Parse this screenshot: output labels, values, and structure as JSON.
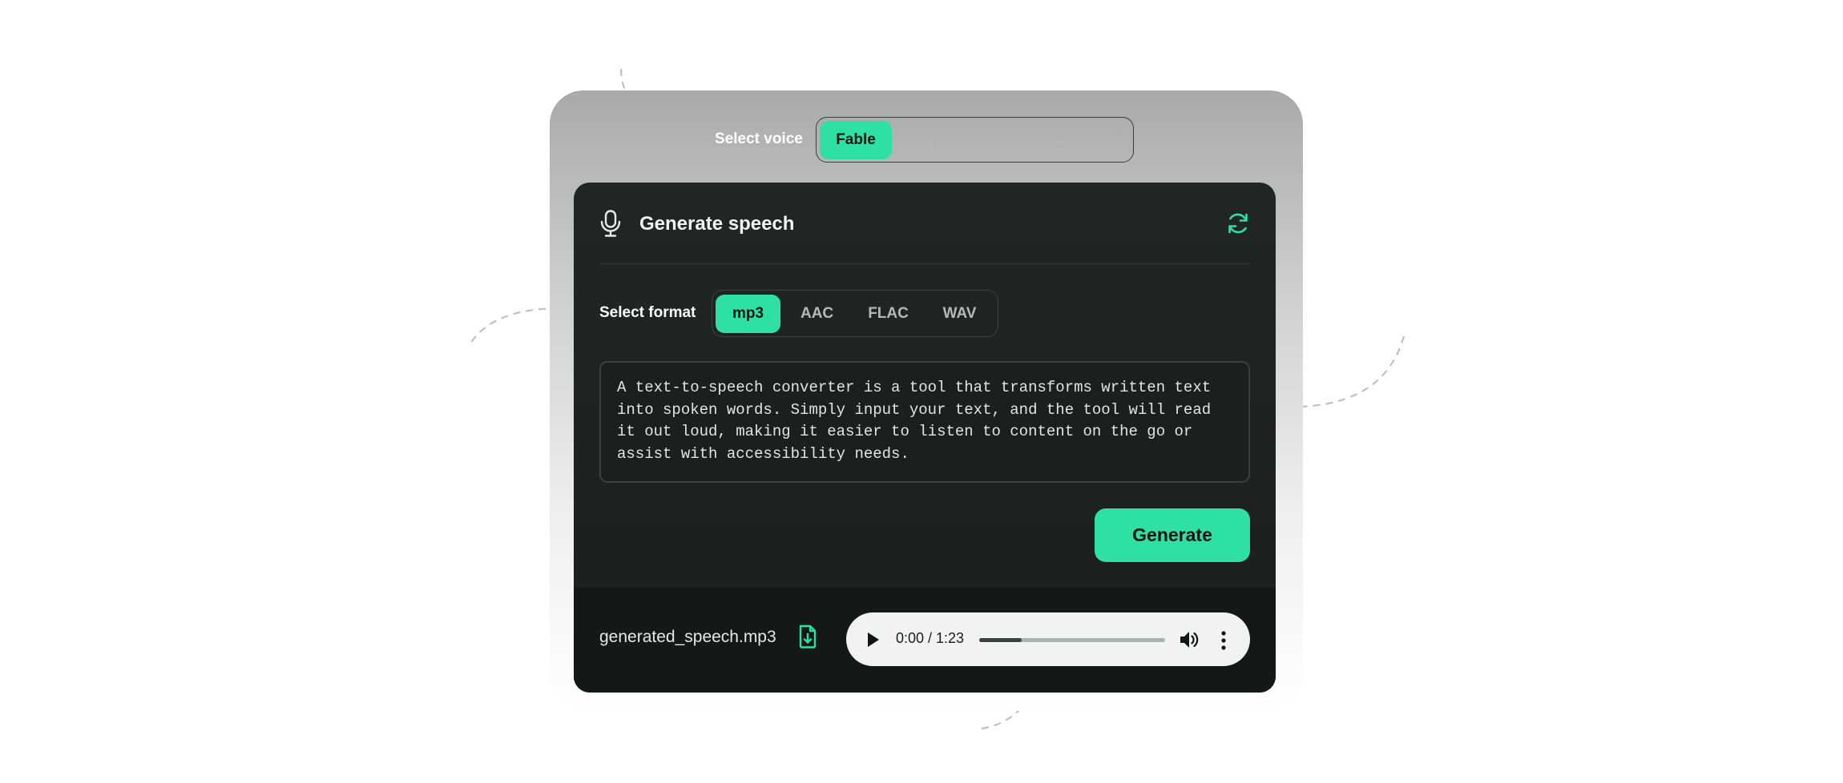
{
  "voice": {
    "label": "Select voice",
    "options": [
      "Fable",
      "Sage",
      "Ash",
      "Shimmer"
    ],
    "selected": "Fable"
  },
  "card": {
    "title": "Generate speech",
    "format_label": "Select format",
    "formats": [
      "mp3",
      "AAC",
      "FLAC",
      "WAV"
    ],
    "selected_format": "mp3",
    "text": "A text-to-speech converter is a tool that transforms written text into spoken words. Simply input your text, and the tool will read it out loud, making it easier to listen to content on the go or assist with accessibility needs.",
    "generate_label": "Generate"
  },
  "output": {
    "filename": "generated_speech.mp3",
    "time": "0:00 / 1:23",
    "progress": 0.23
  },
  "colors": {
    "accent": "#2fe0a6",
    "card_bg": "#1e2222",
    "footer_bg": "#151818"
  },
  "icons": {
    "header": "microphone-icon",
    "refresh": "refresh-icon",
    "download": "file-download-icon",
    "play": "play-icon",
    "volume": "volume-icon",
    "more": "more-vertical-icon"
  }
}
